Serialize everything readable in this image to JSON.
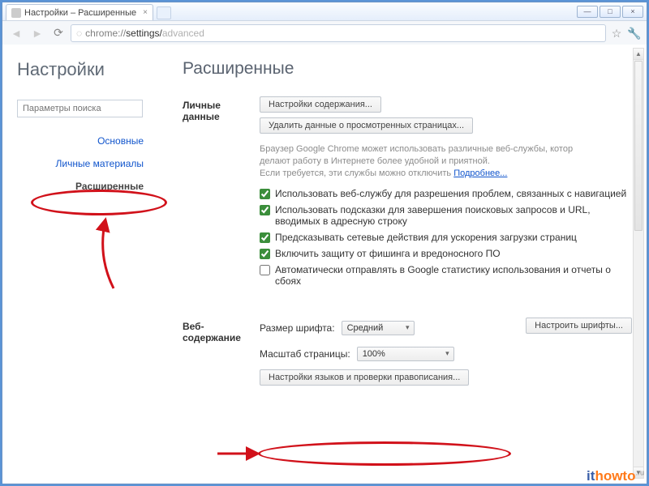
{
  "window": {
    "tab_title": "Настройки – Расширенные"
  },
  "omnibox": {
    "proto": "chrome://",
    "host": "settings/",
    "path": "advanced"
  },
  "sidebar": {
    "title": "Настройки",
    "search_placeholder": "Параметры поиска",
    "items": [
      {
        "label": "Основные"
      },
      {
        "label": "Личные материалы"
      },
      {
        "label": "Расширенные"
      }
    ]
  },
  "main": {
    "title": "Расширенные",
    "privacy": {
      "label": "Личные данные",
      "btn_content": "Настройки содержания...",
      "btn_clear": "Удалить данные о просмотренных страницах...",
      "desc1": "Браузер Google Chrome может использовать различные веб-службы, котор",
      "desc2": "делают работу в Интернете более удобной и приятной.",
      "desc3": "Если требуется, эти службы можно отключить ",
      "more": "Подробнее...",
      "checks": [
        {
          "label": "Использовать веб-службу для разрешения проблем, связанных с навигацией",
          "checked": true
        },
        {
          "label": "Использовать подсказки для завершения поисковых запросов и URL, вводимых в адресную строку",
          "checked": true
        },
        {
          "label": "Предсказывать сетевые действия для ускорения загрузки страниц",
          "checked": true
        },
        {
          "label": "Включить защиту от фишинга и вредоносного ПО",
          "checked": true
        },
        {
          "label": "Автоматически отправлять в Google статистику использования и отчеты о сбоях",
          "checked": false
        }
      ]
    },
    "webcontent": {
      "label": "Веб-содержание",
      "font_label": "Размер шрифта:",
      "font_value": "Средний",
      "btn_fonts": "Настроить шрифты...",
      "zoom_label": "Масштаб страницы:",
      "zoom_value": "100%",
      "btn_lang": "Настройки языков и проверки правописания..."
    }
  },
  "watermark": {
    "t1": "it",
    "t2": "howto",
    "t3": ".ru"
  }
}
